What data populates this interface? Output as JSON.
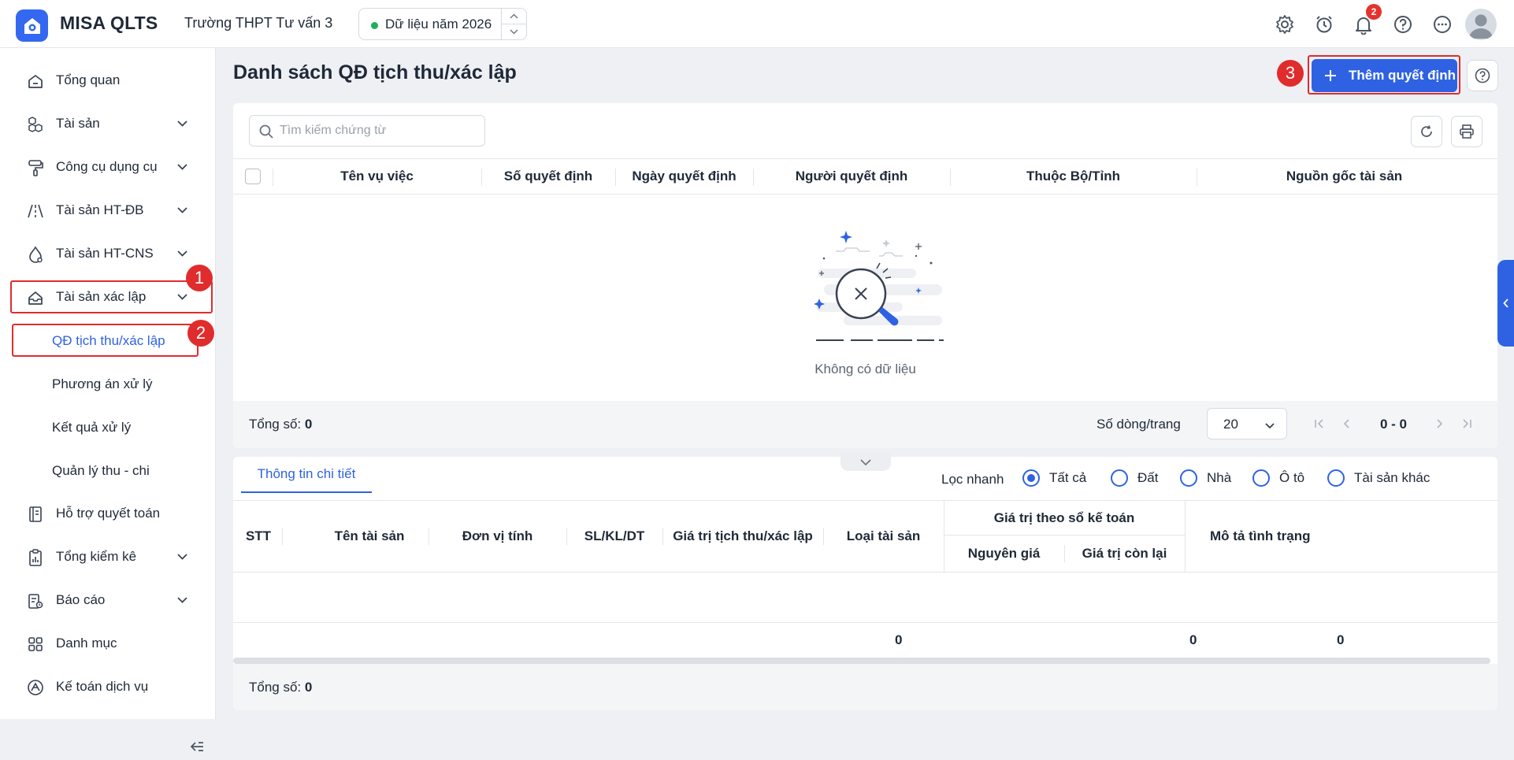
{
  "header": {
    "app_name": "MISA QLTS",
    "school": "Trường THPT Tư vấn 3",
    "year_label": "Dữ liệu năm 2026",
    "notification_count": "2"
  },
  "sidebar": {
    "items": [
      {
        "label": "Tổng quan",
        "icon": "home-icon"
      },
      {
        "label": "Tài sản",
        "icon": "boxes-icon"
      },
      {
        "label": "Công cụ dụng cụ",
        "icon": "paint-roller-icon"
      },
      {
        "label": "Tài sản HT-ĐB",
        "icon": "road-icon"
      },
      {
        "label": "Tài sản HT-CNS",
        "icon": "water-drop-icon"
      },
      {
        "label": "Tài sản xác lập",
        "icon": "inbox-icon"
      },
      {
        "label": "Hỗ trợ quyết toán",
        "icon": "ledger-icon"
      },
      {
        "label": "Tổng kiểm kê",
        "icon": "clipboard-chart-icon"
      },
      {
        "label": "Báo cáo",
        "icon": "report-icon"
      },
      {
        "label": "Danh mục",
        "icon": "grid-icon"
      },
      {
        "label": "Kế toán dịch vụ",
        "icon": "service-icon"
      }
    ],
    "sub_items": [
      {
        "label": "QĐ tịch thu/xác lập"
      },
      {
        "label": "Phương án xử lý"
      },
      {
        "label": "Kết quả xử lý"
      },
      {
        "label": "Quản lý thu - chi"
      }
    ]
  },
  "annotations": {
    "step1": "1",
    "step2": "2",
    "step3": "3"
  },
  "main": {
    "title": "Danh sách QĐ tịch thu/xác lập",
    "add_button": "Thêm quyết định",
    "search_placeholder": "Tìm kiếm chứng từ",
    "columns": [
      "Tên vụ việc",
      "Số quyết định",
      "Ngày quyết định",
      "Người quyết định",
      "Thuộc Bộ/Tỉnh",
      "Nguồn gốc tài sản"
    ],
    "empty_text": "Không có dữ liệu",
    "total_label": "Tổng số:",
    "total_value": "0",
    "rows_per_page_label": "Số dòng/trang",
    "rows_per_page": "20",
    "page_range": "0 - 0"
  },
  "detail": {
    "tab": "Thông tin chi tiết",
    "filter_label": "Lọc nhanh",
    "filters": [
      "Tất cả",
      "Đất",
      "Nhà",
      "Ô tô",
      "Tài sản khác"
    ],
    "selected_filter": "Tất cả",
    "columns": {
      "stt": "STT",
      "name": "Tên tài sản",
      "unit": "Đơn vị tính",
      "qty": "SL/KL/DT",
      "value": "Giá trị tịch thu/xác lập",
      "type": "Loại tài sản",
      "book_group": "Giá trị theo sổ kế toán",
      "original": "Nguyên giá",
      "remaining": "Giá trị còn lại",
      "status": "Mô tả tình trạng"
    },
    "sums": {
      "value": "0",
      "original": "0",
      "remaining": "0"
    },
    "total_label": "Tổng số:",
    "total_value": "0"
  },
  "colors": {
    "accent": "#2f62e3",
    "annotation": "#e02c2c",
    "status_dot": "#1fae5b"
  }
}
